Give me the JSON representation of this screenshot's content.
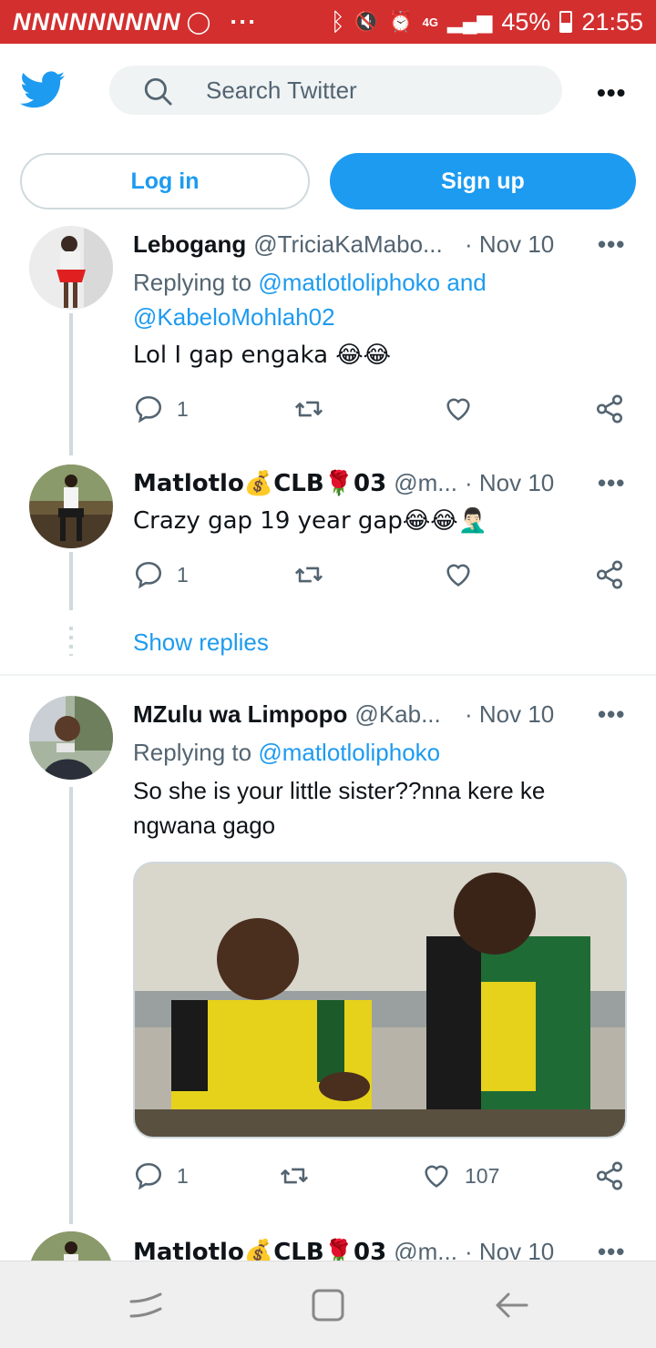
{
  "status_bar": {
    "notifications": "NNNNNNNNN",
    "signal": "4G",
    "battery": "45%",
    "time": "21:55"
  },
  "header": {
    "search_placeholder": "Search Twitter",
    "more": "•••"
  },
  "auth": {
    "login_label": "Log in",
    "signup_label": "Sign up"
  },
  "tweets": [
    {
      "name": "Lebogang",
      "handle": "@TriciaKaMabo...",
      "date": "· Nov 10",
      "replying_prefix": "Replying to",
      "mention1": "@matlotloliphoko and",
      "mention2": "@KabeloMohlah02",
      "text": "Lol I gap engaka 😂😂",
      "replies": "1",
      "retweets": "",
      "likes": ""
    },
    {
      "name": "Matlotlo💰CLB🌹03",
      "handle": "@m...",
      "date": "· Nov 10",
      "text": "Crazy gap 19 year gap😂😂🤦🏻‍♂️",
      "replies": "1",
      "retweets": "",
      "likes": ""
    },
    {
      "name": "MZulu wa Limpopo",
      "handle": "@Kab...",
      "date": "· Nov 10",
      "replying_prefix": "Replying to",
      "mention1": "@matlotloliphoko",
      "text": "So she is your little sister??nna kere ke ngwana gago",
      "replies": "1",
      "retweets": "",
      "likes": "107"
    },
    {
      "name": "Matlotlo💰CLB🌹03",
      "handle": "@m...",
      "date": "· Nov 10"
    }
  ],
  "show_replies": "Show replies",
  "colors": {
    "accent": "#1d9bf0",
    "status_bar": "#d32f2f",
    "muted": "#536471"
  }
}
